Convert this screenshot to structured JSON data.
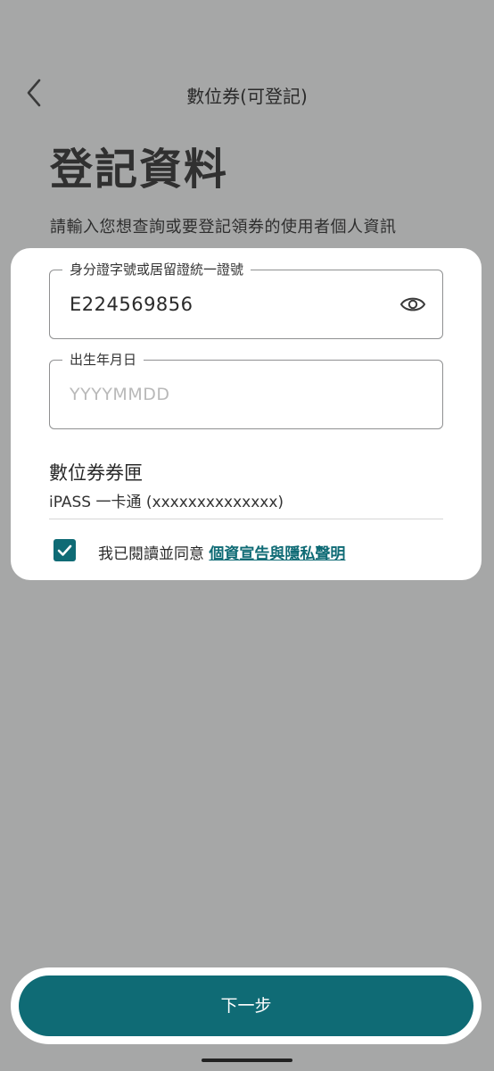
{
  "header": {
    "title": "數位券(可登記)",
    "back_icon": "chevron-left-icon"
  },
  "page": {
    "title": "登記資料",
    "subtitle": "請輸入您想查詢或要登記領券的使用者個人資訊"
  },
  "form": {
    "id_field": {
      "label": "身分證字號或居留證統一證號",
      "value": "E224569856",
      "toggle_icon": "eye-icon"
    },
    "birth_field": {
      "label": "出生年月日",
      "placeholder": "YYYYMMDD",
      "value": ""
    },
    "wallet": {
      "label": "數位券券匣",
      "value": "iPASS 一卡通 (xxxxxxxxxxxxxx)"
    },
    "agreement": {
      "checked": true,
      "text": "我已閱讀並同意 ",
      "link_text": "個資宣告與隱私聲明"
    }
  },
  "footer": {
    "next_label": "下一步"
  },
  "colors": {
    "accent": "#0f6b75",
    "background": "#a6a7a7",
    "card": "#ffffff"
  }
}
